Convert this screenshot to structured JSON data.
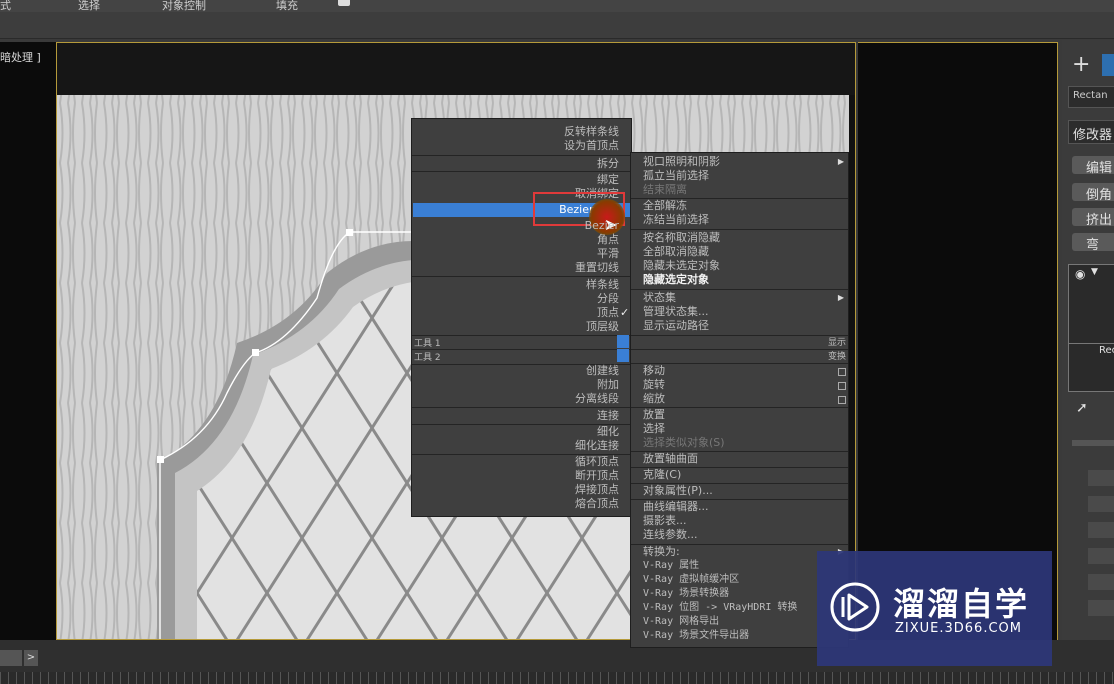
{
  "topmenu": {
    "items": [
      "式",
      "选择",
      "对象控制",
      "填充"
    ]
  },
  "viewport": {
    "label": "暗处理 ]"
  },
  "cmdpanel": {
    "plus": "+",
    "object_name": "Rectan",
    "modifier_list": "修改器",
    "buttons": [
      "编辑",
      "倒角",
      "挤出",
      "弯"
    ],
    "stack_item": "Rec"
  },
  "quad_left": {
    "group1": [
      "反转样条线",
      "设为首顶点"
    ],
    "group2": [
      "拆分"
    ],
    "group3": [
      "绑定",
      "取消绑定"
    ],
    "bezier_corner": "Bezier 角点",
    "group4": [
      "Bezier",
      "角点",
      "平滑",
      "重置切线"
    ],
    "group5": [
      "样条线",
      "分段",
      "顶点",
      "顶层级"
    ],
    "tools1": "工具 1",
    "tools2": "工具 2",
    "group6": [
      "创建线",
      "附加",
      "分离线段"
    ],
    "group7": [
      "连接"
    ],
    "group8": [
      "细化",
      "细化连接"
    ],
    "group9": [
      "循环顶点",
      "断开顶点",
      "焊接顶点",
      "熔合顶点"
    ]
  },
  "quad_right": {
    "group1": [
      "视口照明和阴影",
      "孤立当前选择",
      "结束隔离"
    ],
    "group2": [
      "全部解冻",
      "冻结当前选择"
    ],
    "group3": [
      "按名称取消隐藏",
      "全部取消隐藏",
      "隐藏未选定对象",
      "隐藏选定对象"
    ],
    "group4": [
      "状态集",
      "管理状态集...",
      "显示运动路径"
    ],
    "display": "显示",
    "transform": "变换",
    "group5": [
      "移动",
      "旋转",
      "缩放"
    ],
    "group6": [
      "放置",
      "选择",
      "选择类似对象(S)"
    ],
    "group7": [
      "放置轴曲面"
    ],
    "group8": [
      "克隆(C)"
    ],
    "group9": [
      "对象属性(P)..."
    ],
    "group10": [
      "曲线编辑器...",
      "摄影表...",
      "连线参数..."
    ],
    "group11": [
      "转换为:",
      "V-Ray 属性",
      "V-Ray 虚拟帧缓冲区",
      "V-Ray 场景转换器",
      "V-Ray 位图 -> VRayHDRI 转换",
      "V-Ray 网格导出",
      "V-Ray 场景文件导出器"
    ]
  },
  "watermark": {
    "title": "溜溜自学",
    "url": "ZIXUE.3D66.COM"
  },
  "colors": {
    "accent_blue": "#3a7fd5",
    "frame_gold": "#b59a3a",
    "highlight_red": "#e03a3a",
    "watermark_bg": "#2d3778"
  }
}
